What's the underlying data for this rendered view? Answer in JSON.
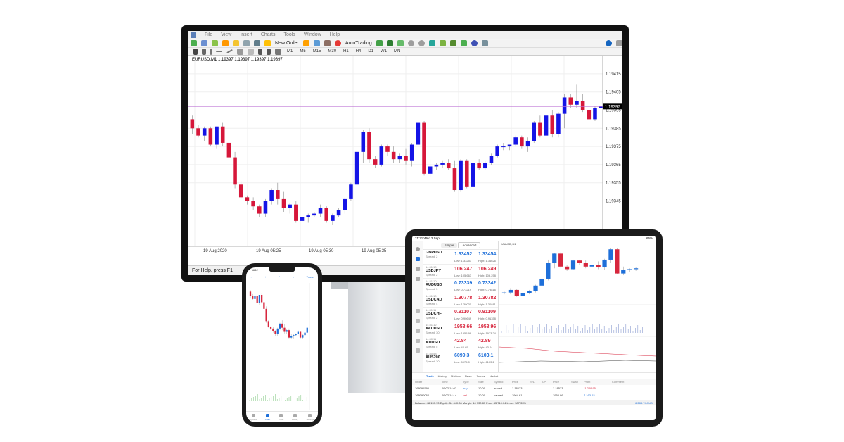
{
  "desktop": {
    "menu": [
      "File",
      "View",
      "Insert",
      "Charts",
      "Tools",
      "Window",
      "Help"
    ],
    "toolbar": {
      "new_order": "New Order",
      "auto_trading": "AutoTrading"
    },
    "timeframes": [
      "M1",
      "M5",
      "M15",
      "M30",
      "H1",
      "H4",
      "D1",
      "W1",
      "MN"
    ],
    "chart_legend": "EURUSD,M1  1.19397 1.19397 1.19397 1.19397",
    "price_labels": [
      "1.19415",
      "1.19405",
      "1.19395",
      "1.19385",
      "1.19375",
      "1.19365",
      "1.19355",
      "1.19345"
    ],
    "current_price": "1.19397",
    "time_labels": [
      "19 Aug 2020",
      "19 Aug 05:25",
      "19 Aug 05:30",
      "19 Aug 05:35",
      "19 Aug 05:42",
      "19 Aug 05:49",
      "19 Aug 05:55"
    ],
    "status": "For Help, press F1",
    "colors": {
      "bull": "#1414e6",
      "bear": "#d6173a",
      "price_line": "#c07ad6"
    }
  },
  "chart_data": {
    "type": "candlestick",
    "ohlc": [
      [
        1.1939,
        1.19392,
        1.19382,
        1.19385
      ],
      [
        1.19385,
        1.19387,
        1.1938,
        1.19381
      ],
      [
        1.19381,
        1.19386,
        1.19378,
        1.19385
      ],
      [
        1.19385,
        1.19386,
        1.19375,
        1.19376
      ],
      [
        1.19376,
        1.19386,
        1.19374,
        1.19386
      ],
      [
        1.19386,
        1.19388,
        1.19375,
        1.19377
      ],
      [
        1.19377,
        1.19378,
        1.19368,
        1.19369
      ],
      [
        1.19369,
        1.19372,
        1.19352,
        1.19354
      ],
      [
        1.19354,
        1.19356,
        1.19346,
        1.19347
      ],
      [
        1.19347,
        1.19348,
        1.19343,
        1.19345
      ],
      [
        1.19345,
        1.19347,
        1.1934,
        1.19342
      ],
      [
        1.19342,
        1.19343,
        1.19336,
        1.19338
      ],
      [
        1.19338,
        1.19346,
        1.19336,
        1.19345
      ],
      [
        1.19345,
        1.19352,
        1.19343,
        1.19351
      ],
      [
        1.19351,
        1.19355,
        1.19343,
        1.19346
      ],
      [
        1.19346,
        1.1935,
        1.19339,
        1.19341
      ],
      [
        1.19341,
        1.19344,
        1.19338,
        1.19343
      ],
      [
        1.19343,
        1.19345,
        1.19333,
        1.19334
      ],
      [
        1.19334,
        1.19338,
        1.19332,
        1.19336
      ],
      [
        1.19336,
        1.19338,
        1.19333,
        1.19337
      ],
      [
        1.19337,
        1.19339,
        1.19336,
        1.19338
      ],
      [
        1.19338,
        1.19343,
        1.19336,
        1.19341
      ],
      [
        1.19341,
        1.19342,
        1.19333,
        1.19334
      ],
      [
        1.19334,
        1.19338,
        1.19332,
        1.19337
      ],
      [
        1.19337,
        1.19341,
        1.19336,
        1.1934
      ],
      [
        1.1934,
        1.19347,
        1.19338,
        1.19346
      ],
      [
        1.19346,
        1.19355,
        1.19345,
        1.19354
      ],
      [
        1.19354,
        1.19376,
        1.19352,
        1.19372
      ],
      [
        1.19372,
        1.19384,
        1.19366,
        1.19383
      ],
      [
        1.19383,
        1.19385,
        1.19366,
        1.19368
      ],
      [
        1.19368,
        1.1937,
        1.19363,
        1.19365
      ],
      [
        1.19365,
        1.19376,
        1.19364,
        1.19375
      ],
      [
        1.19375,
        1.19376,
        1.1937,
        1.19372
      ],
      [
        1.19372,
        1.19375,
        1.19366,
        1.19368
      ],
      [
        1.19368,
        1.19371,
        1.19366,
        1.1937
      ],
      [
        1.1937,
        1.19374,
        1.19365,
        1.19367
      ],
      [
        1.19367,
        1.19377,
        1.19364,
        1.19376
      ],
      [
        1.19376,
        1.19389,
        1.19372,
        1.19388
      ],
      [
        1.19388,
        1.19389,
        1.19359,
        1.1936
      ],
      [
        1.1936,
        1.19368,
        1.19358,
        1.19364
      ],
      [
        1.19364,
        1.19366,
        1.19362,
        1.19365
      ],
      [
        1.19365,
        1.19367,
        1.19363,
        1.19366
      ],
      [
        1.19366,
        1.19368,
        1.19362,
        1.19363
      ],
      [
        1.19363,
        1.19367,
        1.1935,
        1.19351
      ],
      [
        1.19351,
        1.19368,
        1.1935,
        1.19367
      ],
      [
        1.19367,
        1.19368,
        1.19352,
        1.19353
      ],
      [
        1.19353,
        1.19367,
        1.19352,
        1.19366
      ],
      [
        1.19366,
        1.19368,
        1.19362,
        1.19363
      ],
      [
        1.19363,
        1.19367,
        1.19362,
        1.19366
      ],
      [
        1.19366,
        1.19371,
        1.19365,
        1.1937
      ],
      [
        1.1937,
        1.19376,
        1.19369,
        1.19375
      ],
      [
        1.19375,
        1.19377,
        1.19373,
        1.19375
      ],
      [
        1.19375,
        1.19376,
        1.19373,
        1.19376
      ],
      [
        1.19376,
        1.19381,
        1.19375,
        1.1938
      ],
      [
        1.1938,
        1.19381,
        1.19374,
        1.19375
      ],
      [
        1.19375,
        1.1938,
        1.19372,
        1.19378
      ],
      [
        1.19378,
        1.19389,
        1.19377,
        1.19388
      ],
      [
        1.19388,
        1.19392,
        1.1938,
        1.19381
      ],
      [
        1.19381,
        1.19393,
        1.1938,
        1.19392
      ],
      [
        1.19392,
        1.19395,
        1.1938,
        1.19382
      ],
      [
        1.19382,
        1.19394,
        1.1938,
        1.19393
      ],
      [
        1.19393,
        1.19404,
        1.19385,
        1.19402
      ],
      [
        1.19402,
        1.19404,
        1.19396,
        1.19398
      ],
      [
        1.19398,
        1.19409,
        1.19396,
        1.194
      ],
      [
        1.194,
        1.19404,
        1.19394,
        1.19395
      ],
      [
        1.19395,
        1.19398,
        1.19388,
        1.1939
      ],
      [
        1.1939,
        1.19397,
        1.19389,
        1.19396
      ],
      [
        1.19396,
        1.19397,
        1.19395,
        1.19397
      ]
    ],
    "ylim": [
      1.1932,
      1.1942
    ]
  },
  "tablet": {
    "status_left": "21:21  Wed 2 Sep",
    "status_right": "66%",
    "tabs": [
      "Simple",
      "Advanced"
    ],
    "quotes": [
      {
        "time": "",
        "sym": "GBPUSD",
        "spread": "Spread: 2",
        "bid": "1.33452",
        "ask": "1.33454",
        "low": "Low: 1.33253",
        "high": "High: 1.34626",
        "bid_dir": "blue",
        "ask_dir": "blue"
      },
      {
        "time": "14:31:10",
        "sym": "USDJPY",
        "spread": "Spread: 2",
        "bid": "106.247",
        "ask": "106.249",
        "low": "Low: 105.663",
        "high": "High: 106.258",
        "bid_dir": "red",
        "ask_dir": "red"
      },
      {
        "time": "14:31:10",
        "sym": "AUDUSD",
        "spread": "Spread: 3",
        "bid": "0.73339",
        "ask": "0.73342",
        "low": "Low: 0.73219",
        "high": "High: 0.73816",
        "bid_dir": "blue",
        "ask_dir": "blue"
      },
      {
        "time": "14:31:10",
        "sym": "USDCAD",
        "spread": "Spread: 4",
        "bid": "1.30778",
        "ask": "1.30782",
        "low": "Low: 1.30031",
        "high": "High: 1.30881",
        "bid_dir": "red",
        "ask_dir": "red"
      },
      {
        "time": "14:31:11",
        "sym": "USDCHF",
        "spread": "Spread: 2",
        "bid": "0.91107",
        "ask": "0.91109",
        "low": "Low: 0.90649",
        "high": "High: 0.91358",
        "bid_dir": "red",
        "ask_dir": "red"
      },
      {
        "time": "14:31:12",
        "sym": "XAUUSD",
        "spread": "Spread: 30",
        "bid": "1958.66",
        "ask": "1958.96",
        "low": "Low: 1955.99",
        "high": "High: 1973.24",
        "bid_dir": "red",
        "ask_dir": "red"
      },
      {
        "time": "14:30:11",
        "sym": "XTIUSD",
        "spread": "Spread: 5",
        "bid": "42.84",
        "ask": "42.89",
        "low": "Low: 42.65",
        "high": "High: 43.04",
        "bid_dir": "red",
        "ask_dir": "red"
      },
      {
        "time": "14:30:58",
        "sym": "AUS200",
        "spread": "Spread: 30",
        "bid": "6099.3",
        "ask": "6103.1",
        "low": "Low: 5975.0",
        "high": "High: 6103.2",
        "bid_dir": "blue",
        "ask_dir": "blue"
      }
    ],
    "chart_legend": "XAUUSD, M1",
    "trade_tabs": [
      "Trade",
      "History",
      "Mailbox",
      "News",
      "Journal",
      "Market"
    ],
    "trade_head": [
      "Order",
      "Time",
      "Type",
      "Size",
      "Symbol",
      "Price",
      "S/L",
      "T/P",
      "Price",
      "Swap",
      "Profit",
      "Comment"
    ],
    "trades": [
      [
        "168091595",
        "09:02 14:02",
        "buy",
        "10.00",
        "eurusd",
        "1.18623",
        "",
        "",
        "1.18523",
        "",
        "-1 249.95",
        ""
      ],
      [
        "168090062",
        "09:02 14:14",
        "sell",
        "10.00",
        "xauusd",
        "1964.61",
        "",
        "",
        "1958.96",
        "",
        "7 163.62",
        ""
      ]
    ],
    "balance": "Balance: 48 157.13 Equity: 54 440.86 Margin: 10 730.83 Free: 43 710.04 Level: 507.33%",
    "total_profit": "6 283.74  AUD"
  },
  "phone": {
    "status_left": "16:12",
    "top_right": "Trade",
    "tabs": [
      "Quotes",
      "Chart",
      "Trade",
      "History",
      "Settings"
    ]
  }
}
